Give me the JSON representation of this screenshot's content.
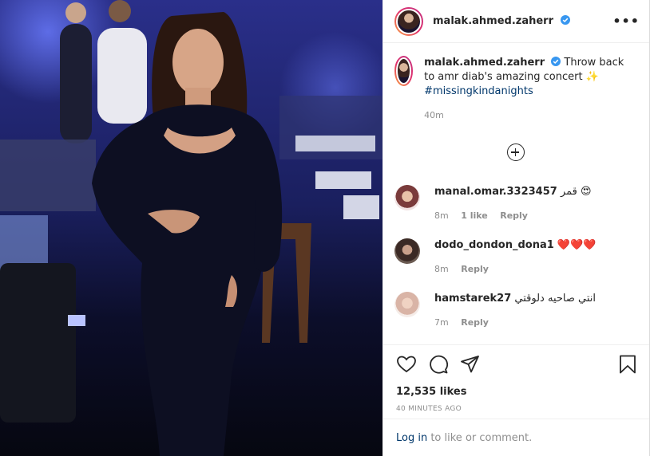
{
  "post": {
    "username": "malak.ahmed.zaherr",
    "caption_text": "Throw back to amr diab's amazing concert ✨",
    "hashtag": "#missingkindanights",
    "caption_time": "40m"
  },
  "comments": [
    {
      "username": "manal.omar.3323457",
      "text": "قمر 😍",
      "time": "8m",
      "likes": "1 like",
      "reply": "Reply"
    },
    {
      "username": "dodo_dondon_dona1",
      "text": "❤️❤️❤️",
      "time": "8m",
      "likes": "",
      "reply": "Reply"
    },
    {
      "username": "hamstarek27",
      "text": "انتي صاحيه دلوقتي",
      "time": "7m",
      "likes": "",
      "reply": "Reply"
    }
  ],
  "stats": {
    "likes": "12,535 likes",
    "posted": "40 MINUTES AGO"
  },
  "login": {
    "link": "Log in",
    "rest": " to like or comment."
  },
  "icons": [
    "more-icon",
    "verified-icon",
    "add-circle-icon",
    "heart-icon",
    "comment-icon",
    "share-icon",
    "bookmark-icon"
  ],
  "colors": {
    "link": "#00376b",
    "verified": "#3897f0",
    "muted": "#8e8e8e"
  }
}
